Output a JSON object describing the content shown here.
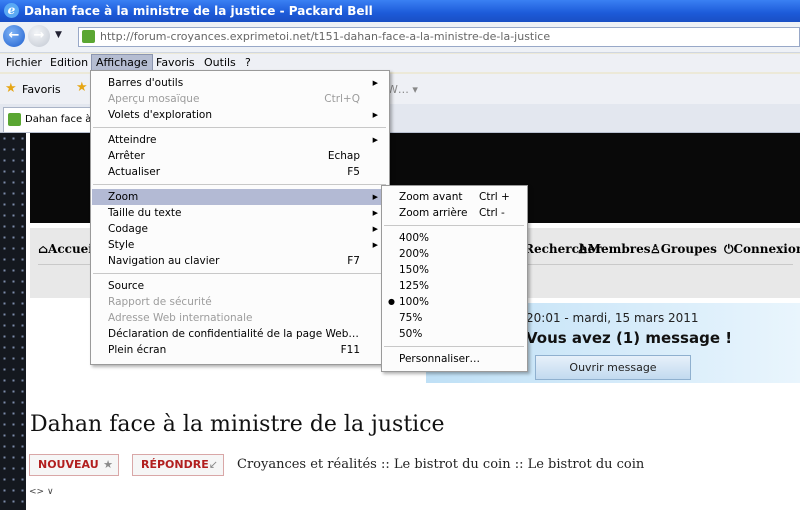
{
  "window": {
    "title": "Dahan face à la ministre de la justice - Packard Bell"
  },
  "address_bar": {
    "url": "http://forum-croyances.exprimetoi.net/t151-dahan-face-a-la-ministre-de-la-justice"
  },
  "menubar": {
    "items": [
      "Fichier",
      "Edition",
      "Affichage",
      "Favoris",
      "Outils",
      "?"
    ],
    "active": "Affichage"
  },
  "favorites_bar": {
    "label": "Favoris",
    "extra": "W… ▾"
  },
  "tab": {
    "label": "Dahan face à l"
  },
  "view_menu": {
    "items": [
      {
        "label": "Barres d'outils",
        "submenu": true
      },
      {
        "label": "Aperçu mosaïque",
        "shortcut": "Ctrl+Q",
        "disabled": true
      },
      {
        "label": "Volets d'exploration",
        "submenu": true
      },
      {
        "label": "Atteindre",
        "submenu": true
      },
      {
        "label": "Arrêter",
        "shortcut": "Echap"
      },
      {
        "label": "Actualiser",
        "shortcut": "F5"
      },
      {
        "label": "Zoom",
        "submenu": true,
        "highlighted": true
      },
      {
        "label": "Taille du texte",
        "submenu": true
      },
      {
        "label": "Codage",
        "submenu": true
      },
      {
        "label": "Style",
        "submenu": true
      },
      {
        "label": "Navigation au clavier",
        "shortcut": "F7"
      },
      {
        "label": "Source"
      },
      {
        "label": "Rapport de sécurité",
        "disabled": true
      },
      {
        "label": "Adresse Web internationale",
        "disabled": true
      },
      {
        "label": "Déclaration de confidentialité de la page Web…"
      },
      {
        "label": "Plein écran",
        "shortcut": "F11"
      }
    ]
  },
  "zoom_menu": {
    "items": [
      {
        "label": "Zoom avant",
        "shortcut": "Ctrl +"
      },
      {
        "label": "Zoom arrière",
        "shortcut": "Ctrl -"
      },
      {
        "label": "400%"
      },
      {
        "label": "200%"
      },
      {
        "label": "150%"
      },
      {
        "label": "125%"
      },
      {
        "label": "100%",
        "selected": true
      },
      {
        "label": "75%"
      },
      {
        "label": "50%"
      },
      {
        "label": "Personnaliser…"
      }
    ]
  },
  "page": {
    "nav": {
      "home": "Accueil",
      "search": "Rechercher",
      "members": "Membres",
      "groups": "Groupes",
      "login": "Connexion"
    },
    "datetime": "20:01 - mardi, 15 mars 2011",
    "messages": "Vous avez (1) message !",
    "open_messages": "Ouvrir message",
    "post_title": "Dahan face à la ministre de la justice",
    "new_topic": "NOUVEAU",
    "reply": "RÉPONDRE",
    "breadcrumb": "Croyances et réalités :: Le bistrot du coin :: Le bistrot du coin",
    "small_nav": "<> ∨"
  }
}
